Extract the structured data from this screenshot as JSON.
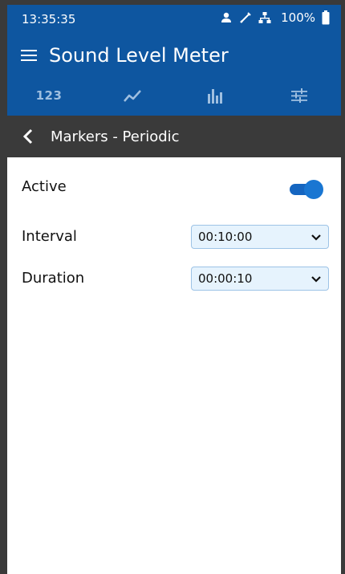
{
  "status": {
    "time": "13:35:35",
    "battery": "100%"
  },
  "appbar": {
    "title": "Sound Level Meter"
  },
  "tabs": [
    {
      "label": "123",
      "icon": "numbers-icon"
    },
    {
      "label": "",
      "icon": "trend-line-icon"
    },
    {
      "label": "",
      "icon": "bar-chart-icon"
    },
    {
      "label": "",
      "icon": "sliders-icon"
    }
  ],
  "subheader": {
    "title": "Markers - Periodic"
  },
  "settings": {
    "active": {
      "label": "Active",
      "value": true
    },
    "interval": {
      "label": "Interval",
      "value": "00:10:00"
    },
    "duration": {
      "label": "Duration",
      "value": "00:00:10"
    }
  },
  "colors": {
    "primary": "#0e56a0",
    "subheader": "#3a3a3a",
    "accent": "#1976d2",
    "select_bg": "#e6f3fd"
  }
}
